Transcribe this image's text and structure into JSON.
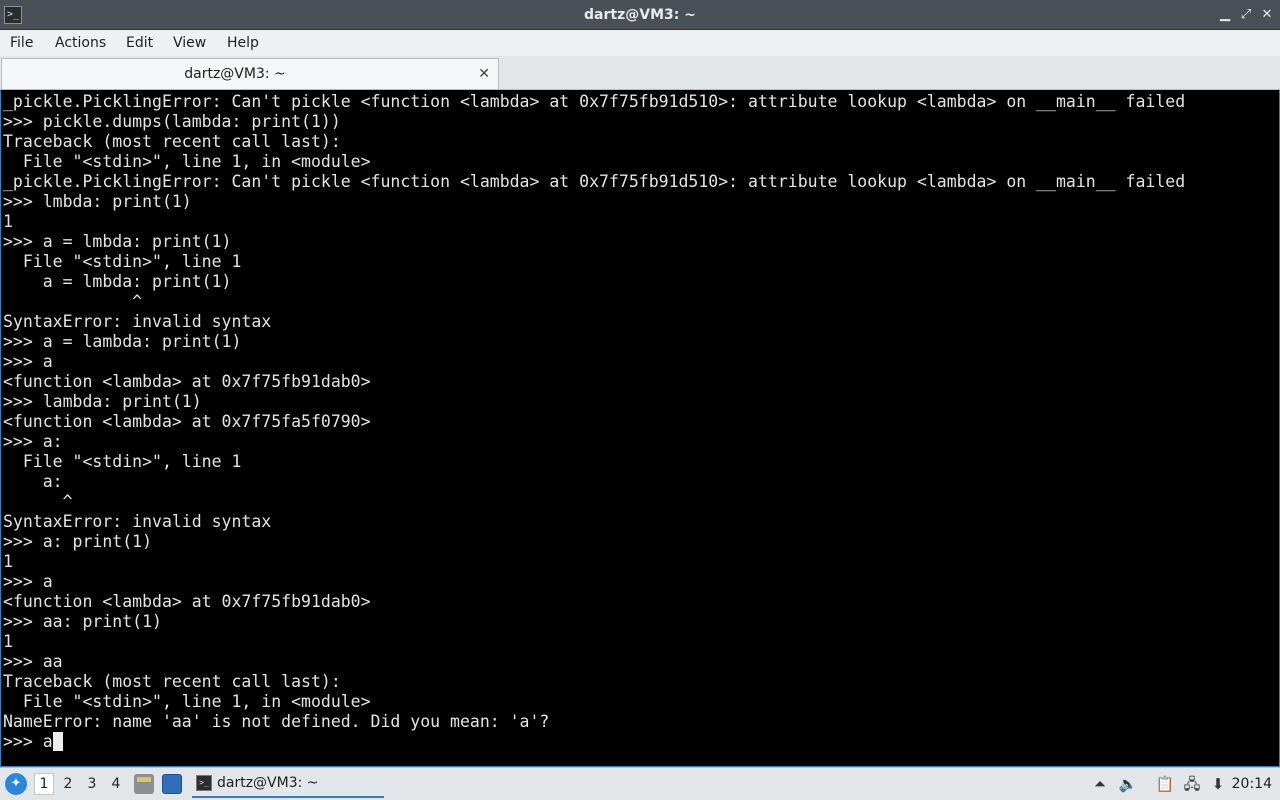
{
  "window": {
    "title": "dartz@VM3: ~",
    "app_icon_glyph": ">_",
    "controls": {
      "minimize": "▁",
      "restore": "⤢",
      "close": "✕"
    }
  },
  "menu": {
    "items": [
      "File",
      "Actions",
      "Edit",
      "View",
      "Help"
    ]
  },
  "tab": {
    "label": "dartz@VM3: ~",
    "close_glyph": "✕"
  },
  "terminal": {
    "lines": [
      "_pickle.PicklingError: Can't pickle <function <lambda> at 0x7f75fb91d510>: attribute lookup <lambda> on __main__ failed",
      ">>> pickle.dumps(lambda: print(1))",
      "Traceback (most recent call last):",
      "  File \"<stdin>\", line 1, in <module>",
      "_pickle.PicklingError: Can't pickle <function <lambda> at 0x7f75fb91d510>: attribute lookup <lambda> on __main__ failed",
      ">>> lmbda: print(1)",
      "1",
      ">>> a = lmbda: print(1)",
      "  File \"<stdin>\", line 1",
      "    a = lmbda: print(1)",
      "             ^",
      "SyntaxError: invalid syntax",
      ">>> a = lambda: print(1)",
      ">>> a",
      "<function <lambda> at 0x7f75fb91dab0>",
      ">>> lambda: print(1)",
      "<function <lambda> at 0x7f75fa5f0790>",
      ">>> a:",
      "  File \"<stdin>\", line 1",
      "    a:",
      "      ^",
      "SyntaxError: invalid syntax",
      ">>> a: print(1)",
      "1",
      ">>> a",
      "<function <lambda> at 0x7f75fb91dab0>",
      ">>> aa: print(1)",
      "1",
      ">>> aa",
      "Traceback (most recent call last):",
      "  File \"<stdin>\", line 1, in <module>",
      "NameError: name 'aa' is not defined. Did you mean: 'a'?"
    ],
    "prompt_line": ">>> a"
  },
  "taskbar": {
    "desktops": [
      "1",
      "2",
      "3",
      "4"
    ],
    "active_desktop": "1",
    "task_label": "dartz@VM3: ~",
    "clock": "20:14",
    "icons": [
      "start-menu-icon",
      "file-manager-icon",
      "show-desktop-icon",
      "terminal-icon",
      "tray-arrow-icon",
      "volume-icon",
      "clipboard-icon",
      "network-icon",
      "update-icon"
    ]
  }
}
